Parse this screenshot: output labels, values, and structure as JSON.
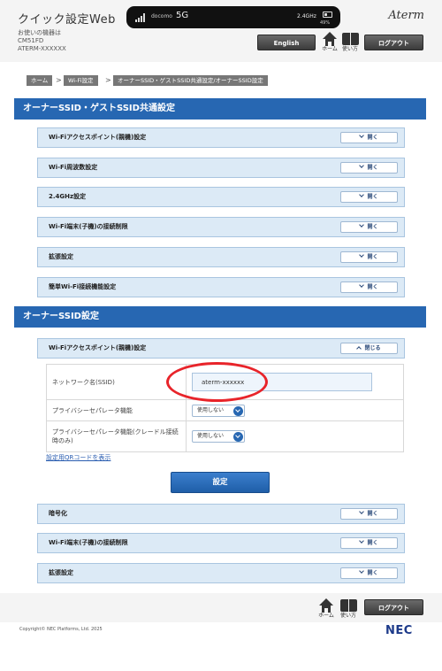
{
  "header": {
    "title": "クイック設定Web",
    "device_caption": "お使いの機器は",
    "device_model": "CM51FD",
    "device_ssid": "ATERM-XXXXXX",
    "brand": "Aterm",
    "status": {
      "carrier": "docomo",
      "network": "5G",
      "wifi": "2.4GHz",
      "battery": "49%",
      "battery_level": 0.49
    },
    "english_label": "English",
    "home_label": "ホーム",
    "help_label": "使い方",
    "logout_label": "ログアウト"
  },
  "breadcrumb": [
    "ホーム",
    "Wi-Fi設定",
    "オーナーSSID・ゲストSSID共通設定/オーナーSSID設定"
  ],
  "section1": {
    "title": "オーナーSSID・ゲストSSID共通設定",
    "items": [
      {
        "label": "Wi-Fiアクセスポイント(親機)設定",
        "toggle": "開く"
      },
      {
        "label": "Wi-Fi周波数設定",
        "toggle": "開く"
      },
      {
        "label": "2.4GHz設定",
        "toggle": "開く"
      },
      {
        "label": "Wi-Fi端末(子機)の接続制限",
        "toggle": "開く"
      },
      {
        "label": "拡張設定",
        "toggle": "開く"
      },
      {
        "label": "簡単Wi-Fi接続機能設定",
        "toggle": "開く"
      }
    ]
  },
  "section2": {
    "title": "オーナーSSID設定",
    "expanded": {
      "label": "Wi-Fiアクセスポイント(親機)設定",
      "toggle": "閉じる"
    },
    "fields": {
      "ssid_label": "ネットワーク名(SSID)",
      "ssid_value": "aterm-xxxxxx",
      "privacy_label": "プライバシーセパレータ機能",
      "privacy_value": "使用しない",
      "privacy_cradle_label": "プライバシーセパレータ機能(クレードル接続時のみ)",
      "privacy_cradle_value": "使用しない"
    },
    "qr_link": "設定用QRコードを表示",
    "submit_label": "設定",
    "items": [
      {
        "label": "暗号化",
        "toggle": "開く"
      },
      {
        "label": "Wi-Fi端末(子機)の接続制限",
        "toggle": "開く"
      },
      {
        "label": "拡張設定",
        "toggle": "開く"
      }
    ]
  },
  "footer": {
    "home_label": "ホーム",
    "help_label": "使い方",
    "logout_label": "ログアウト",
    "copyright": "Copyright© NEC Platforms, Ltd. 2025",
    "logo": "NEC"
  }
}
